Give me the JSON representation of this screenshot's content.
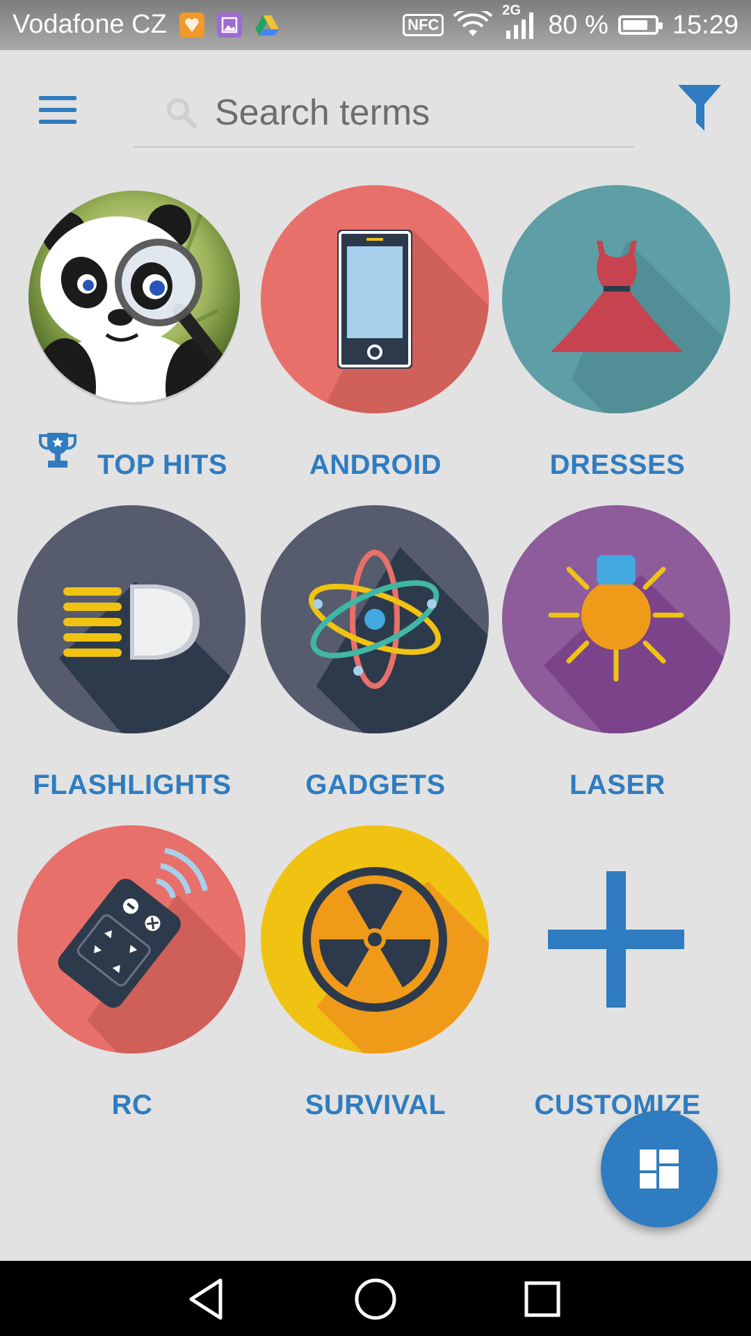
{
  "status_bar": {
    "carrier": "Vodafone CZ",
    "notification_icons": [
      "photo-app-icon",
      "gallery-icon",
      "drive-icon"
    ],
    "nfc_label": "NFC",
    "network_label": "2G",
    "battery_text": "80 %",
    "battery_level": 0.8,
    "time": "15:29"
  },
  "toolbar": {
    "menu_icon": "hamburger-menu-icon",
    "search_placeholder": "Search terms",
    "filter_icon": "filter-icon"
  },
  "categories": [
    {
      "label": "TOP HITS",
      "icon": "panda-magnifier-icon",
      "badge_icon": "trophy-icon"
    },
    {
      "label": "ANDROID",
      "icon": "smartphone-icon",
      "color": "#e8706a"
    },
    {
      "label": "DRESSES",
      "icon": "dress-icon",
      "color": "#5e9ea6"
    },
    {
      "label": "FLASHLIGHTS",
      "icon": "flashlight-icon",
      "color": "#565b6e"
    },
    {
      "label": "GADGETS",
      "icon": "atom-icon",
      "color": "#565b6e"
    },
    {
      "label": "LASER",
      "icon": "laser-sun-icon",
      "color": "#8e5b9b"
    },
    {
      "label": "RC",
      "icon": "remote-control-icon",
      "color": "#e8706a"
    },
    {
      "label": "SURVIVAL",
      "icon": "radiation-icon",
      "color": "#f0c313"
    },
    {
      "label": "CUSTOMIZE",
      "icon": "plus-icon"
    }
  ],
  "fab": {
    "icon": "dashboard-icon"
  },
  "nav_bar": {
    "icons": [
      "back-icon",
      "home-icon",
      "recents-icon"
    ]
  },
  "colors": {
    "accent": "#2f7cc0",
    "background": "#e2e2e2"
  }
}
